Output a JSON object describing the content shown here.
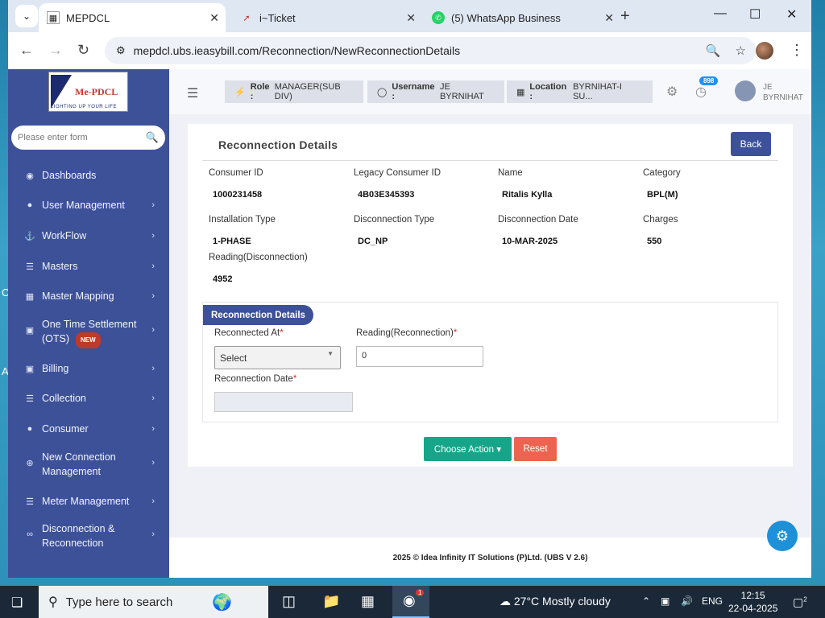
{
  "browser": {
    "tabs": [
      {
        "title": "MEPDCL",
        "active": true
      },
      {
        "title": "i~Ticket",
        "active": false
      },
      {
        "title": "(5) WhatsApp Business",
        "active": false
      }
    ],
    "url": "mepdcl.ubs.ieasybill.com/Reconnection/NewReconnectionDetails"
  },
  "sidebar": {
    "logo_text": "Me-PDCL",
    "logo_tagline": "LIGHTING UP YOUR LIFE",
    "search_placeholder": "Please enter form",
    "items": [
      {
        "label": "Dashboards",
        "icon": "palette-icon"
      },
      {
        "label": "User Management",
        "icon": "user-icon"
      },
      {
        "label": "WorkFlow",
        "icon": "anchor-icon"
      },
      {
        "label": "Masters",
        "icon": "list-icon"
      },
      {
        "label": "Master Mapping",
        "icon": "sitemap-icon"
      },
      {
        "label": "One Time Settlement",
        "label2": "(OTS)",
        "badge": "NEW",
        "icon": "monitor-icon"
      },
      {
        "label": "Billing",
        "icon": "monitor-icon"
      },
      {
        "label": "Collection",
        "icon": "list-icon"
      },
      {
        "label": "Consumer",
        "icon": "user-icon"
      },
      {
        "label": "New Connection",
        "label2": "Management",
        "icon": "plus-circle-icon"
      },
      {
        "label": "Meter Management",
        "icon": "list-icon"
      },
      {
        "label": "Disconnection &",
        "label2": "Reconnection",
        "icon": "link-icon"
      }
    ]
  },
  "header": {
    "role_label": "Role :",
    "role_value": "MANAGER(SUB DIV)",
    "username_label": "Username :",
    "username_value": "JE BYRNIHAT",
    "location_label": "Location :",
    "location_value": "BYRNIHAT-I SU...",
    "notification_count": "898",
    "user_line1": "JE",
    "user_line2": "BYRNIHAT"
  },
  "page": {
    "title": "Reconnection Details",
    "back_label": "Back",
    "fields": [
      {
        "label": "Consumer ID",
        "value": "1000231458"
      },
      {
        "label": "Legacy Consumer ID",
        "value": "4B03E345393"
      },
      {
        "label": "Name",
        "value": "Ritalis Kylla"
      },
      {
        "label": "Category",
        "value": "BPL(M)"
      },
      {
        "label": "Installation Type",
        "value": "1-PHASE"
      },
      {
        "label": "Disconnection Type",
        "value": "DC_NP"
      },
      {
        "label": "Disconnection Date",
        "value": "10-MAR-2025"
      },
      {
        "label": "Charges",
        "value": "550"
      },
      {
        "label": "Reading(Disconnection)",
        "value": "4952"
      }
    ],
    "section_title": "Reconnection Details",
    "reconnected_at_label": "Reconnected At",
    "reconnected_at_value": "Select",
    "reading_label": "Reading(Reconnection)",
    "reading_value": "0",
    "date_label": "Reconnection Date",
    "required_mark": "*",
    "choose_action_label": "Choose Action ▾",
    "reset_label": "Reset"
  },
  "footer": "2025 © Idea Infinity IT Solutions (P)Ltd. (UBS V 2.6)",
  "taskbar": {
    "search_placeholder": "Type here to search",
    "weather": "27°C  Mostly cloudy",
    "language": "ENG",
    "time": "12:15",
    "date": "22-04-2025",
    "notifications": "2",
    "chrome_badge": "1"
  }
}
